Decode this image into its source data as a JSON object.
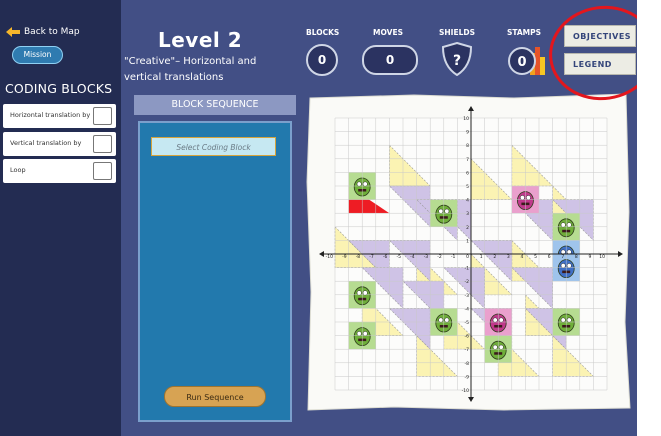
{
  "nav": {
    "back_label": "Back to Map",
    "mission_label": "Mission"
  },
  "sidebar": {
    "title": "CODING BLOCKS",
    "blocks": [
      {
        "label": "Horizontal translation by"
      },
      {
        "label": "Vertical translation by"
      },
      {
        "label": "Loop"
      }
    ]
  },
  "level": {
    "title": "Level 2",
    "subtitle": "\"Creative\"– Horizontal and vertical translations"
  },
  "stats": {
    "blocks_label": "BLOCKS",
    "blocks_value": "0",
    "moves_label": "MOVES",
    "moves_value": "0",
    "shields_label": "SHIELDS",
    "shields_value": "?",
    "stamps_label": "STAMPS",
    "stamps_value": "0"
  },
  "buttons": {
    "objectives": "OBJECTIVES",
    "legend": "LEGEND",
    "run": "Run Sequence"
  },
  "sequence": {
    "header": "BLOCK SEQUENCE",
    "select_placeholder": "Select Coding Block"
  },
  "grid": {
    "x_ticks": [
      "-10",
      "-9",
      "-8",
      "-7",
      "-6",
      "-5",
      "-4",
      "-3",
      "-2",
      "-1",
      "0",
      "1",
      "2",
      "3",
      "4",
      "5",
      "6",
      "7",
      "8",
      "9",
      "10"
    ],
    "y_ticks": [
      "10",
      "9",
      "8",
      "7",
      "6",
      "5",
      "4",
      "3",
      "2",
      "1",
      "-1",
      "-2",
      "-3",
      "-4",
      "-5",
      "-6",
      "-7",
      "-8",
      "-9",
      "-10"
    ],
    "colors": {
      "yellow": "#fbf3b3",
      "purple": "#cfc3e6",
      "green": "#b6dc91",
      "pink": "#eaa0cd",
      "blue": "#9fc4ec",
      "red": "#ee1c24",
      "grid_bg": "#fcfcfb"
    }
  },
  "icons": [
    "back-arrow-icon",
    "shield-icon",
    "stamp-icon",
    "green-monster-icon",
    "pink-monster-icon",
    "blue-monster-icon"
  ]
}
